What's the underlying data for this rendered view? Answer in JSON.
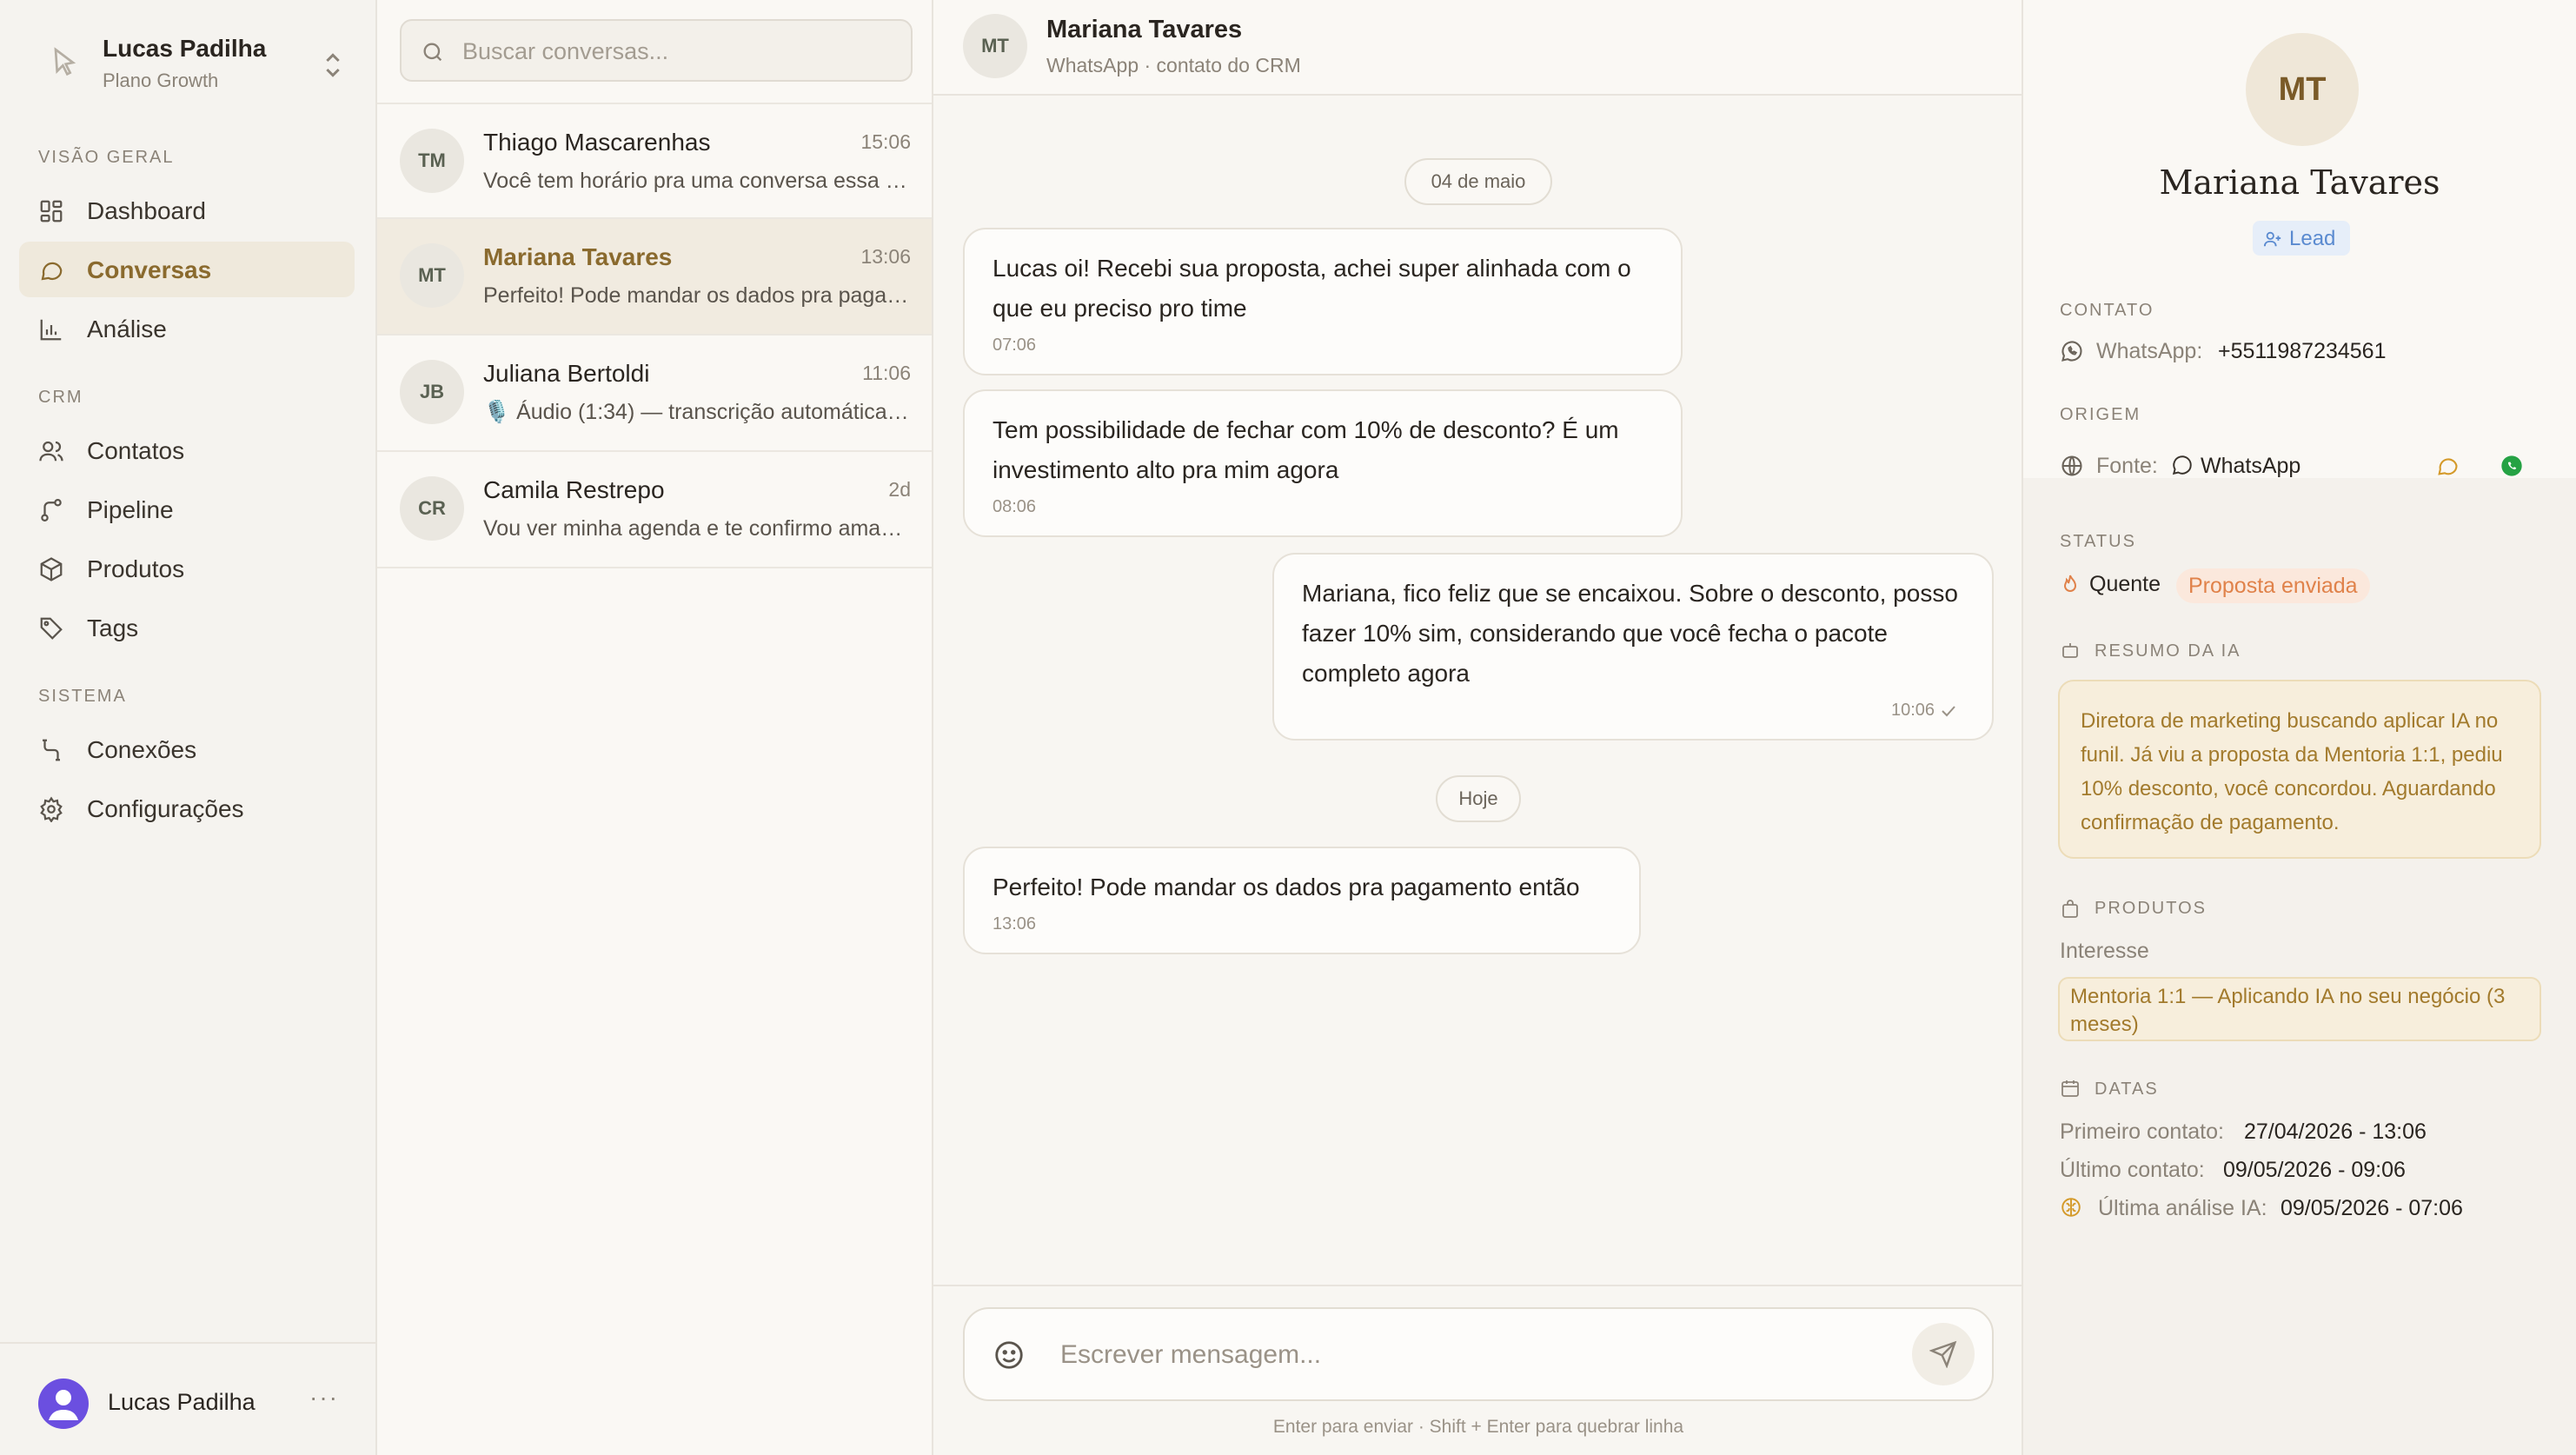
{
  "workspace": {
    "user_name": "Lucas Padilha",
    "plan": "Plano Growth"
  },
  "sidebar": {
    "sections": [
      {
        "title": "VISÃO GERAL"
      },
      {
        "title": "CRM"
      },
      {
        "title": "SISTEMA"
      }
    ],
    "items": [
      {
        "label": "Dashboard",
        "icon": "dashboard-icon"
      },
      {
        "label": "Conversas",
        "icon": "chat-icon",
        "active": true
      },
      {
        "label": "Análise",
        "icon": "bar-chart-icon"
      },
      {
        "label": "Contatos",
        "icon": "users-icon"
      },
      {
        "label": "Pipeline",
        "icon": "pipeline-icon"
      },
      {
        "label": "Produtos",
        "icon": "package-icon"
      },
      {
        "label": "Tags",
        "icon": "tag-icon"
      },
      {
        "label": "Conexões",
        "icon": "connections-icon"
      },
      {
        "label": "Configurações",
        "icon": "gear-icon"
      }
    ],
    "footer_user": "Lucas Padilha",
    "footer_more": "···"
  },
  "search": {
    "placeholder": "Buscar conversas..."
  },
  "conversations": [
    {
      "initials": "TM",
      "name": "Thiago Mascarenhas",
      "time": "15:06",
      "preview": "Você tem horário pra uma conversa essa semana?"
    },
    {
      "initials": "MT",
      "name": "Mariana Tavares",
      "time": "13:06",
      "preview": "Perfeito! Pode mandar os dados pra pagamento então",
      "active": true
    },
    {
      "initials": "JB",
      "name": "Juliana Bertoldi",
      "time": "11:06",
      "preview": "🎙️ Áudio (1:34) — transcrição automática: oi Lucas"
    },
    {
      "initials": "CR",
      "name": "Camila Restrepo",
      "time": "2d",
      "preview": "Vou ver minha agenda e te confirmo amanhã"
    }
  ],
  "chat": {
    "header": {
      "initials": "MT",
      "name": "Mariana Tavares",
      "subtitle": "WhatsApp · contato do CRM"
    },
    "date_pills": [
      "04 de maio",
      "Hoje"
    ],
    "messages": [
      {
        "direction": "in",
        "text": "Lucas oi! Recebi sua proposta, achei super alinhada com o que eu preciso pro time",
        "time": "07:06"
      },
      {
        "direction": "in",
        "text": "Tem possibilidade de fechar com 10% de desconto? É um investimento alto pra mim agora",
        "time": "08:06"
      },
      {
        "direction": "out",
        "text": "Mariana, fico feliz que se encaixou. Sobre o desconto, posso fazer 10% sim, considerando que você fecha o pacote completo agora",
        "time": "10:06"
      },
      {
        "direction": "in",
        "text": "Perfeito! Pode mandar os dados pra pagamento então",
        "time": "13:06"
      }
    ],
    "composer_placeholder": "Escrever mensagem...",
    "hint": "Enter para enviar · Shift + Enter para quebrar linha"
  },
  "profile": {
    "initials": "MT",
    "name": "Mariana Tavares",
    "badge": "Lead",
    "contact": {
      "title": "CONTATO",
      "label": "WhatsApp:",
      "value": "+5511987234561"
    },
    "origin": {
      "title": "ORIGEM",
      "label": "Fonte:",
      "value": "WhatsApp"
    },
    "status": {
      "title": "STATUS",
      "temperature": "Quente",
      "stage": "Proposta enviada"
    },
    "ai_summary": {
      "title": "RESUMO DA IA",
      "text": "Diretora de marketing buscando aplicar IA no funil. Já viu a proposta da Mentoria 1:1, pediu 10% desconto, você concordou. Aguardando confirmação de pagamento."
    },
    "products": {
      "title": "PRODUTOS",
      "label": "Interesse",
      "item": "Mentoria 1:1 — Aplicando IA no seu negócio (3 meses)"
    },
    "dates": {
      "title": "DATAS",
      "first_label": "Primeiro contato:",
      "first_value": "27/04/2026 - 13:06",
      "last_label": "Último contato:",
      "last_value": "09/05/2026 - 09:06",
      "ai_label": "Última análise IA:",
      "ai_value": "09/05/2026 - 07:06"
    }
  },
  "colors": {
    "accent": "#8a6a2e",
    "active_bg": "#efe9dc",
    "lead_blue": "#5a8ad0",
    "whatsapp_green": "#25a244",
    "warm_orange": "#e0824a"
  }
}
